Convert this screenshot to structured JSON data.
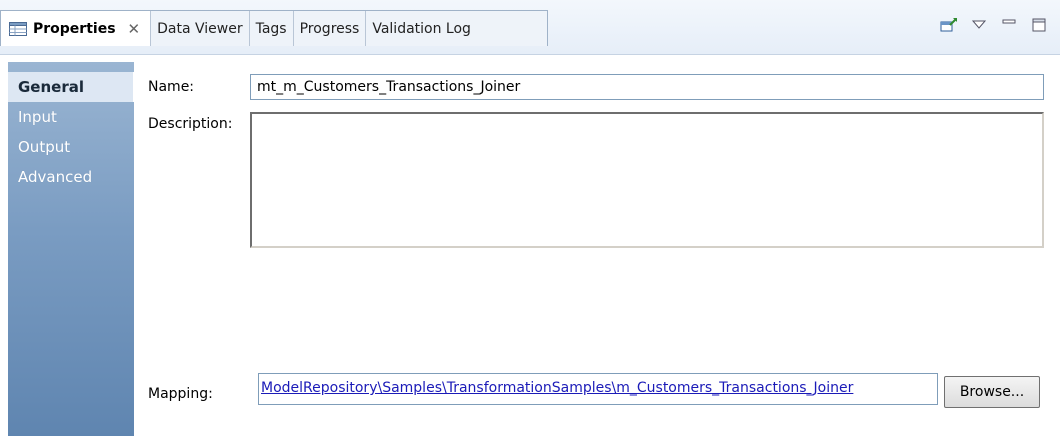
{
  "tabs": [
    {
      "label": "Properties",
      "active": true
    },
    {
      "label": "Data Viewer",
      "active": false
    },
    {
      "label": "Tags",
      "active": false
    },
    {
      "label": "Progress",
      "active": false
    },
    {
      "label": "Validation Log",
      "active": false
    }
  ],
  "close_glyph": "✕",
  "nav": {
    "items": [
      "General",
      "Input",
      "Output",
      "Advanced"
    ],
    "selected": "General"
  },
  "form": {
    "name_label": "Name:",
    "name_value": "mt_m_Customers_Transactions_Joiner",
    "description_label": "Description:",
    "description_value": "",
    "mapping_label": "Mapping:",
    "mapping_value": "ModelRepository\\Samples\\TransformationSamples\\m_Customers_Transactions_Joiner",
    "browse_label": "Browse..."
  },
  "colors": {
    "nav_top": "#9ab5d2",
    "nav_bottom": "#5f85b0",
    "link": "#1b1bb8"
  },
  "icons": [
    "properties-table-icon",
    "close-icon",
    "pin-icon",
    "view-menu-icon",
    "minimize-icon",
    "maximize-icon"
  ]
}
